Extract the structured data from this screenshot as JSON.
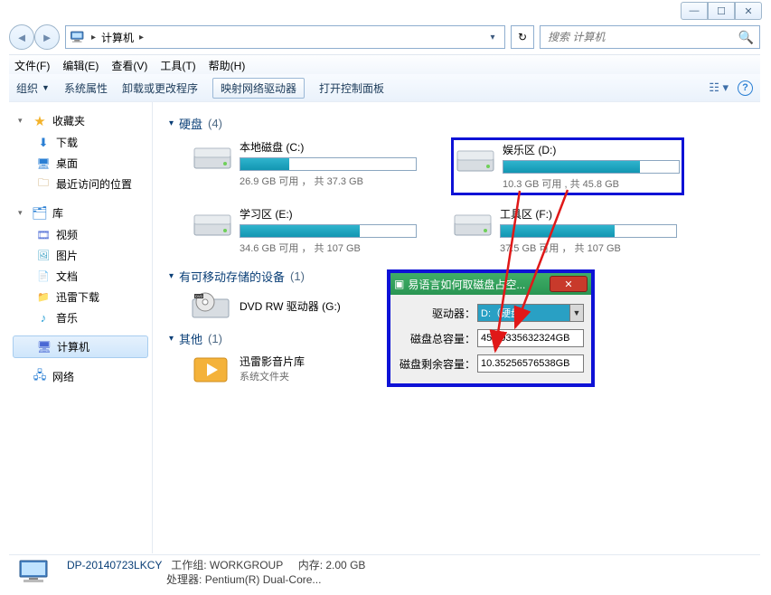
{
  "window_controls": {
    "min": "—",
    "max": "☐",
    "close": "✕"
  },
  "address": {
    "root": "计算机",
    "chev": "▸"
  },
  "refresh_glyph": "↻",
  "search": {
    "placeholder": "搜索 计算机",
    "icon": "🔍"
  },
  "menubar": [
    "文件(F)",
    "编辑(E)",
    "查看(V)",
    "工具(T)",
    "帮助(H)"
  ],
  "toolbar": {
    "organize": "组织",
    "items": [
      "系统属性",
      "卸载或更改程序",
      "映射网络驱动器",
      "打开控制面板"
    ]
  },
  "sidebar": {
    "favorites": {
      "label": "收藏夹",
      "items": [
        "下载",
        "桌面",
        "最近访问的位置"
      ]
    },
    "libraries": {
      "label": "库",
      "items": [
        "视频",
        "图片",
        "文档",
        "迅雷下载",
        "音乐"
      ]
    },
    "computer": {
      "label": "计算机"
    },
    "network": {
      "label": "网络"
    }
  },
  "sections": {
    "hdd": {
      "title": "硬盘",
      "count": "(4)"
    },
    "removable": {
      "title": "有可移动存储的设备",
      "count": "(1)"
    },
    "other": {
      "title": "其他",
      "count": "(1)"
    }
  },
  "drives": [
    {
      "name": "本地磁盘 (C:)",
      "free": "26.9 GB 可用 ， 共 37.3 GB",
      "fill": 28
    },
    {
      "name": "娱乐区 (D:)",
      "free": "10.3 GB 可用 , 共 45.8 GB",
      "fill": 78,
      "highlight": true
    },
    {
      "name": "学习区 (E:)",
      "free": "34.6 GB 可用 ， 共 107 GB",
      "fill": 68
    },
    {
      "name": "工具区 (F:)",
      "free": "37.5 GB 可用 ， 共 107 GB",
      "fill": 65
    }
  ],
  "dvd": {
    "name": "DVD RW 驱动器 (G:)"
  },
  "other_item": {
    "name": "迅雷影音片库",
    "sub": "系统文件夹"
  },
  "details": {
    "name": "DP-20140723LKCY",
    "workgroup_label": "工作组:",
    "workgroup": "WORKGROUP",
    "mem_label": "内存:",
    "mem": "2.00 GB",
    "cpu_label": "处理器:",
    "cpu": "Pentium(R) Dual-Core..."
  },
  "dialog": {
    "title": "易语言如何取磁盘占空...",
    "drive_label": "驱动器：",
    "drive_value": "D:（硬盘）",
    "total_label": "磁盘总容量：",
    "total_value": "45.89335632324GB",
    "free_label": "磁盘剩余容量：",
    "free_value": "10.35256576538GB"
  }
}
